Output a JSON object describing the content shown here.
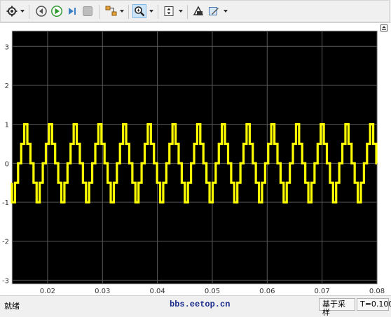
{
  "toolbar": {
    "buttons": [
      {
        "name": "settings-icon"
      },
      {
        "name": "step-back-icon"
      },
      {
        "name": "run-icon"
      },
      {
        "name": "step-forward-icon"
      },
      {
        "name": "stop-icon"
      },
      {
        "name": "signal-selection-icon"
      },
      {
        "name": "zoom-icon"
      },
      {
        "name": "autoscale-icon"
      },
      {
        "name": "highlight-block-icon"
      },
      {
        "name": "style-icon"
      }
    ]
  },
  "plot": {
    "background": "#000000",
    "grid_color": "#5a5a5a",
    "signal_color": "#ffff00",
    "y_ticks": [
      "3",
      "2",
      "1",
      "0",
      "-1",
      "-2",
      "-3"
    ],
    "x_ticks": [
      "0.02",
      "0.03",
      "0.04",
      "0.05",
      "0.06",
      "0.07",
      "0.08"
    ]
  },
  "chart_data": {
    "type": "line",
    "title": "",
    "xlabel": "",
    "ylabel": "",
    "xlim": [
      0.0135,
      0.08
    ],
    "ylim": [
      -3.1,
      3.4
    ],
    "grid": true,
    "series": [
      {
        "color": "#ffff00",
        "waveform": "stepped triangle wave, levels -1, -0.5, 0, 0.5, 1",
        "period": 0.0045,
        "amplitude": 1
      }
    ]
  },
  "status": {
    "left": "就绪",
    "center": "bbs.eetop.cn",
    "mode": "基于采样",
    "time": "T=0.100"
  }
}
